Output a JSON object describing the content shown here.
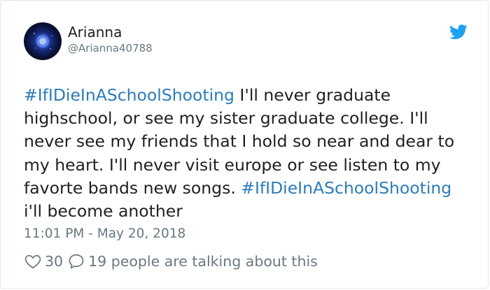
{
  "author": {
    "name": "Arianna",
    "handle": "@Arianna40788"
  },
  "tweet": {
    "lines": [
      {
        "hashtag": "#IfIDieInASchoolShooting",
        "text": " I'll never graduate"
      },
      {
        "text": "highschool, or see my sister graduate college. I'll"
      },
      {
        "text": "never see my friends that I hold so near and dear to"
      },
      {
        "text": "my heart. I'll never visit europe or see listen to my"
      },
      {
        "text": "favorte bands new songs. ",
        "hashtag": "#IfIDieInASchoolShooting"
      },
      {
        "text": "i'll become another"
      }
    ],
    "timestamp": "11:01 PM - May 20, 2018"
  },
  "actions": {
    "likes": "30",
    "replies": "19 people are talking about this"
  },
  "icons": {
    "brand": "twitter-bird-icon",
    "like": "heart-icon",
    "reply": "speech-bubble-icon"
  },
  "colors": {
    "hashtag": "#2b7bb9",
    "brand": "#1da1f2",
    "secondary_text": "#697882",
    "primary_text": "#1c2022"
  }
}
